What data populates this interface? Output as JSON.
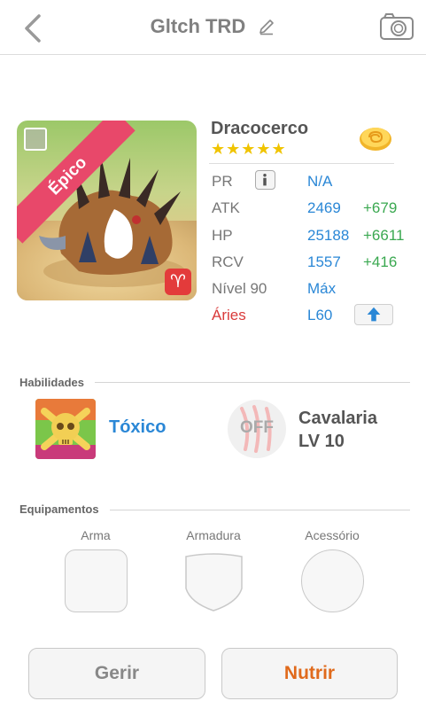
{
  "header": {
    "title": "Gltch TRD"
  },
  "monster": {
    "rarity": "Épico",
    "name": "Dracocerco",
    "stars": "★★★★★",
    "star_count": 5,
    "stats": [
      {
        "label": "PR",
        "value": "N/A",
        "bonus": ""
      },
      {
        "label": "ATK",
        "value": "2469",
        "bonus": "+679"
      },
      {
        "label": "HP",
        "value": "25188",
        "bonus": "+6611"
      },
      {
        "label": "RCV",
        "value": "1557",
        "bonus": "+416"
      },
      {
        "label": "Nível 90",
        "value": "Máx",
        "bonus": ""
      },
      {
        "label": "Áries",
        "value": "L60",
        "bonus": ""
      }
    ],
    "zodiac_symbol": "♈"
  },
  "skills": {
    "section_title": "Habilidades",
    "active_name": "Tóxico",
    "passive_status": "OFF",
    "passive_name_line1": "Cavalaria",
    "passive_name_line2": "LV 10"
  },
  "equipment": {
    "section_title": "Equipamentos",
    "slots": [
      "Arma",
      "Armadura",
      "Acessório"
    ]
  },
  "actions": {
    "manage_label": "Gerir",
    "feed_label": "Nutrir"
  },
  "colors": {
    "accent_blue": "#2a87d6",
    "bonus_green": "#3aa850",
    "epic_pink": "#e8486a",
    "aries_red": "#d93a3a",
    "feed_orange": "#e06a1c"
  },
  "icons": [
    "back-arrow-icon",
    "edit-pencil-icon",
    "camera-icon",
    "gold-coin-icon",
    "info-icon",
    "upgrade-arrow-icon",
    "aries-icon",
    "toxic-skull-icon",
    "claw-icon"
  ]
}
